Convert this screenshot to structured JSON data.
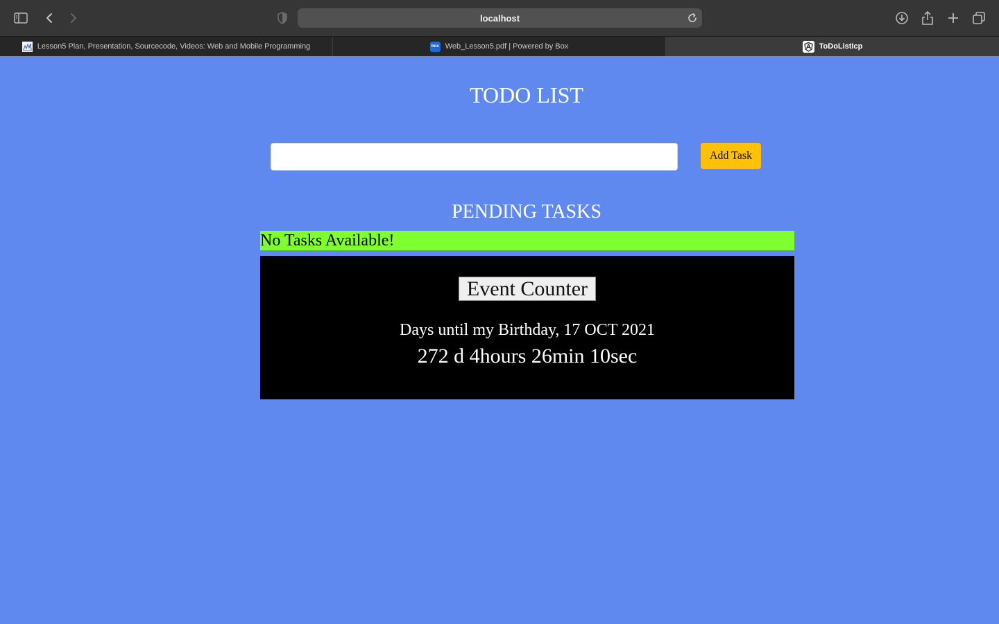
{
  "browser": {
    "address": "localhost",
    "tabs": [
      {
        "label": "Lesson5 Plan, Presentation, Sourcecode, Videos: Web and Mobile Programming",
        "favicon": "chart-icon"
      },
      {
        "label": "Web_Lesson5.pdf | Powered by Box",
        "favicon": "box-logo-icon",
        "favicon_text": "box"
      },
      {
        "label": "ToDoListIcp",
        "favicon": "angular-logo-icon"
      }
    ]
  },
  "app": {
    "title": "TODO LIST",
    "task_input": {
      "value": "",
      "placeholder": ""
    },
    "add_task_label": "Add Task",
    "pending_heading": "PENDING TASKS",
    "no_tasks_text": "No Tasks Available!",
    "event_counter_label": "Event Counter",
    "birthday_label": "Days until my Birthday, 17 OCT 2021",
    "countdown": "272 d 4hours 26min 10sec"
  },
  "colors": {
    "page_background": "#6089ef",
    "add_button": "#ffc107",
    "no_tasks_bar": "#7fff2f",
    "event_panel": "#000000"
  }
}
